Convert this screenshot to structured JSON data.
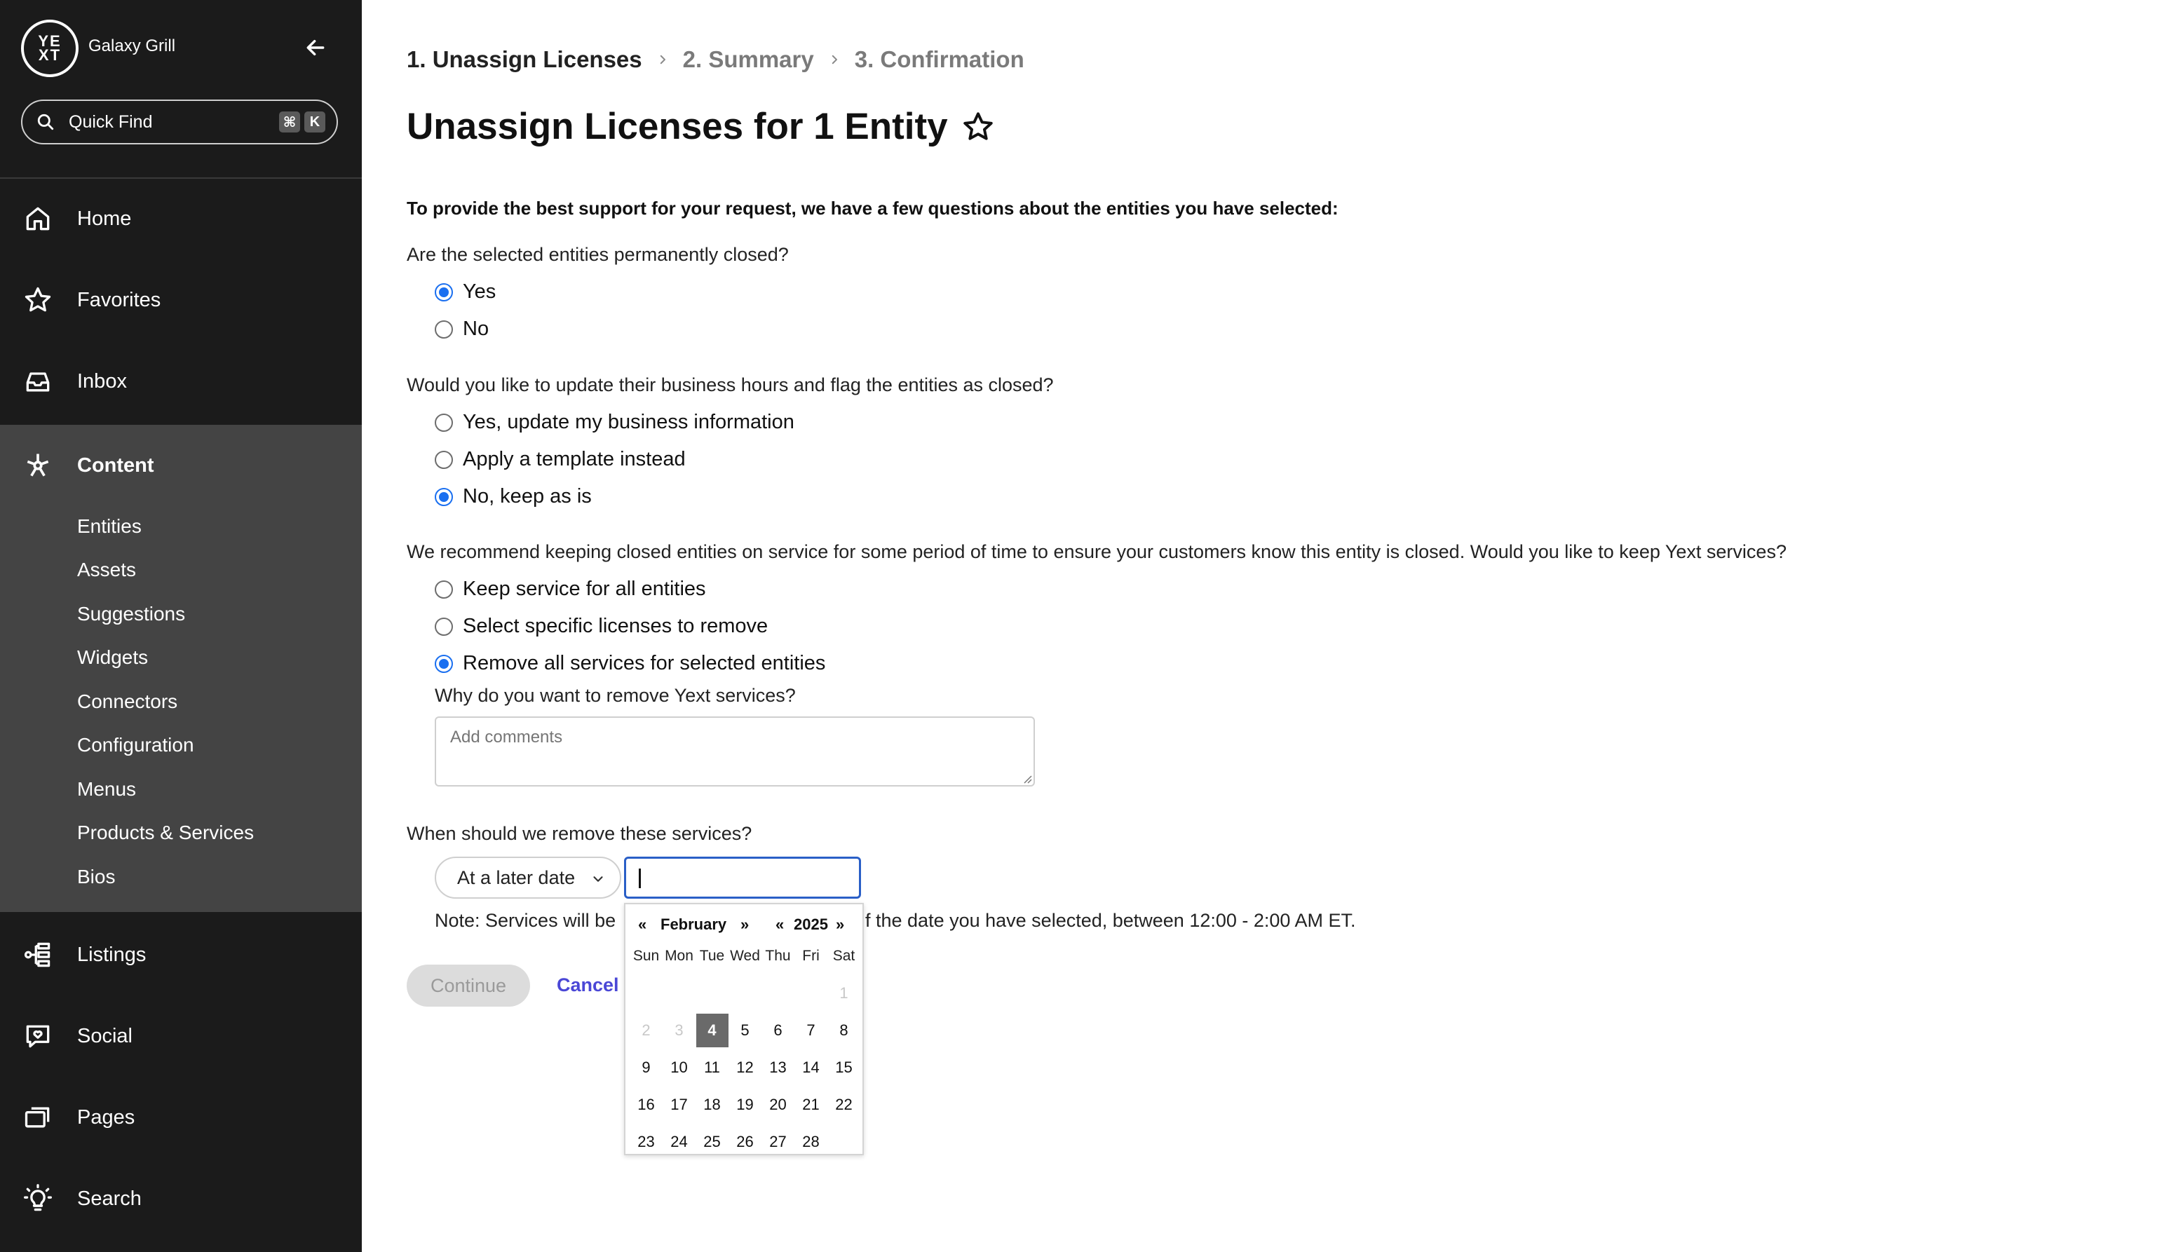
{
  "sidebar": {
    "logo_text_top": "YE",
    "logo_text_bottom": "XT",
    "org_name": "Galaxy Grill",
    "quick_find": {
      "label": "Quick Find",
      "keys": [
        "⌘",
        "K"
      ]
    },
    "nav": [
      {
        "label": "Home",
        "icon": "home-icon"
      },
      {
        "label": "Favorites",
        "icon": "star-icon"
      },
      {
        "label": "Inbox",
        "icon": "inbox-icon"
      },
      {
        "label": "Content",
        "icon": "content-icon",
        "active": true
      },
      {
        "label": "Listings",
        "icon": "listings-icon"
      },
      {
        "label": "Social",
        "icon": "social-icon"
      },
      {
        "label": "Pages",
        "icon": "pages-icon"
      },
      {
        "label": "Search",
        "icon": "lightbulb-icon"
      }
    ],
    "content_subnav": [
      "Entities",
      "Assets",
      "Suggestions",
      "Widgets",
      "Connectors",
      "Configuration",
      "Menus",
      "Products & Services",
      "Bios"
    ]
  },
  "breadcrumb": [
    "1. Unassign Licenses",
    "2. Summary",
    "3. Confirmation"
  ],
  "page_title": "Unassign Licenses for 1 Entity",
  "intro": "To provide the best support for your request, we have a few questions about the entities you have selected:",
  "questions": {
    "q1": {
      "text": "Are the selected entities permanently closed?",
      "options": [
        "Yes",
        "No"
      ],
      "selected": 0
    },
    "q2": {
      "text": "Would you like to update their business hours and flag the entities as closed?",
      "options": [
        "Yes, update my business information",
        "Apply a template instead",
        "No, keep as is"
      ],
      "selected": 2
    },
    "q3": {
      "text": "We recommend keeping closed entities on service for some period of time to ensure your customers know this entity is closed. Would you like to keep Yext services?",
      "options": [
        "Keep service for all entities",
        "Select specific licenses to remove",
        "Remove all services for selected entities"
      ],
      "selected": 2
    },
    "reason": {
      "text": "Why do you want to remove Yext services?",
      "placeholder": "Add comments"
    },
    "when": {
      "text": "When should we remove these services?",
      "select_value": "At a later date",
      "date_value": ""
    }
  },
  "note": {
    "left": "Note: Services will be",
    "right": "f the date you have selected, between 12:00 - 2:00 AM ET."
  },
  "buttons": {
    "continue": "Continue",
    "cancel": "Cancel"
  },
  "datepicker": {
    "prev_month": "«",
    "month": "February",
    "next_month": "»",
    "prev_year": "«",
    "year": "2025",
    "next_year": "»",
    "weekdays": [
      "Sun",
      "Mon",
      "Tue",
      "Wed",
      "Thu",
      "Fri",
      "Sat"
    ],
    "weeks": [
      [
        "",
        "",
        "",
        "",
        "",
        "",
        "1"
      ],
      [
        "2",
        "3",
        "4",
        "5",
        "6",
        "7",
        "8"
      ],
      [
        "9",
        "10",
        "11",
        "12",
        "13",
        "14",
        "15"
      ],
      [
        "16",
        "17",
        "18",
        "19",
        "20",
        "21",
        "22"
      ],
      [
        "23",
        "24",
        "25",
        "26",
        "27",
        "28",
        ""
      ]
    ],
    "muted_days": [
      "1",
      "2",
      "3"
    ],
    "selected_day": "4"
  },
  "colors": {
    "sidebar_bg": "#1b1b1b",
    "content_block_bg": "#444444",
    "radio_accent": "#1a6ff0",
    "cancel_link": "#4a47d6",
    "focus_border": "#2a5fc7"
  }
}
